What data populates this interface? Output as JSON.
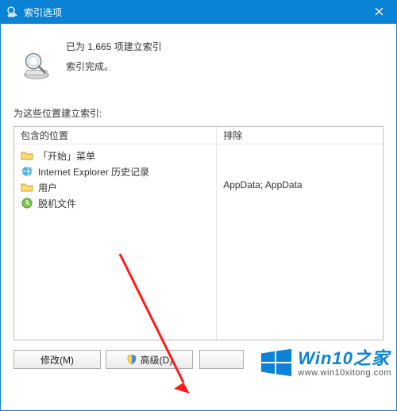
{
  "titlebar": {
    "title": "索引选项"
  },
  "status": {
    "line1": "已为 1,665 项建立索引",
    "line2": "索引完成。"
  },
  "sub_label": "为这些位置建立索引:",
  "columns": {
    "left": "包含的位置",
    "right": "排除"
  },
  "locations": [
    {
      "icon": "folder",
      "label": "「开始」菜单"
    },
    {
      "icon": "ie",
      "label": "Internet Explorer 历史记录"
    },
    {
      "icon": "folder",
      "label": "用户",
      "exclude": "AppData; AppData"
    },
    {
      "icon": "offline",
      "label": "脱机文件"
    }
  ],
  "buttons": {
    "modify": "修改(M)",
    "advanced": "高级(D)"
  },
  "watermark": {
    "text": "Win10之家",
    "sub": "www.win10xitong.com"
  }
}
